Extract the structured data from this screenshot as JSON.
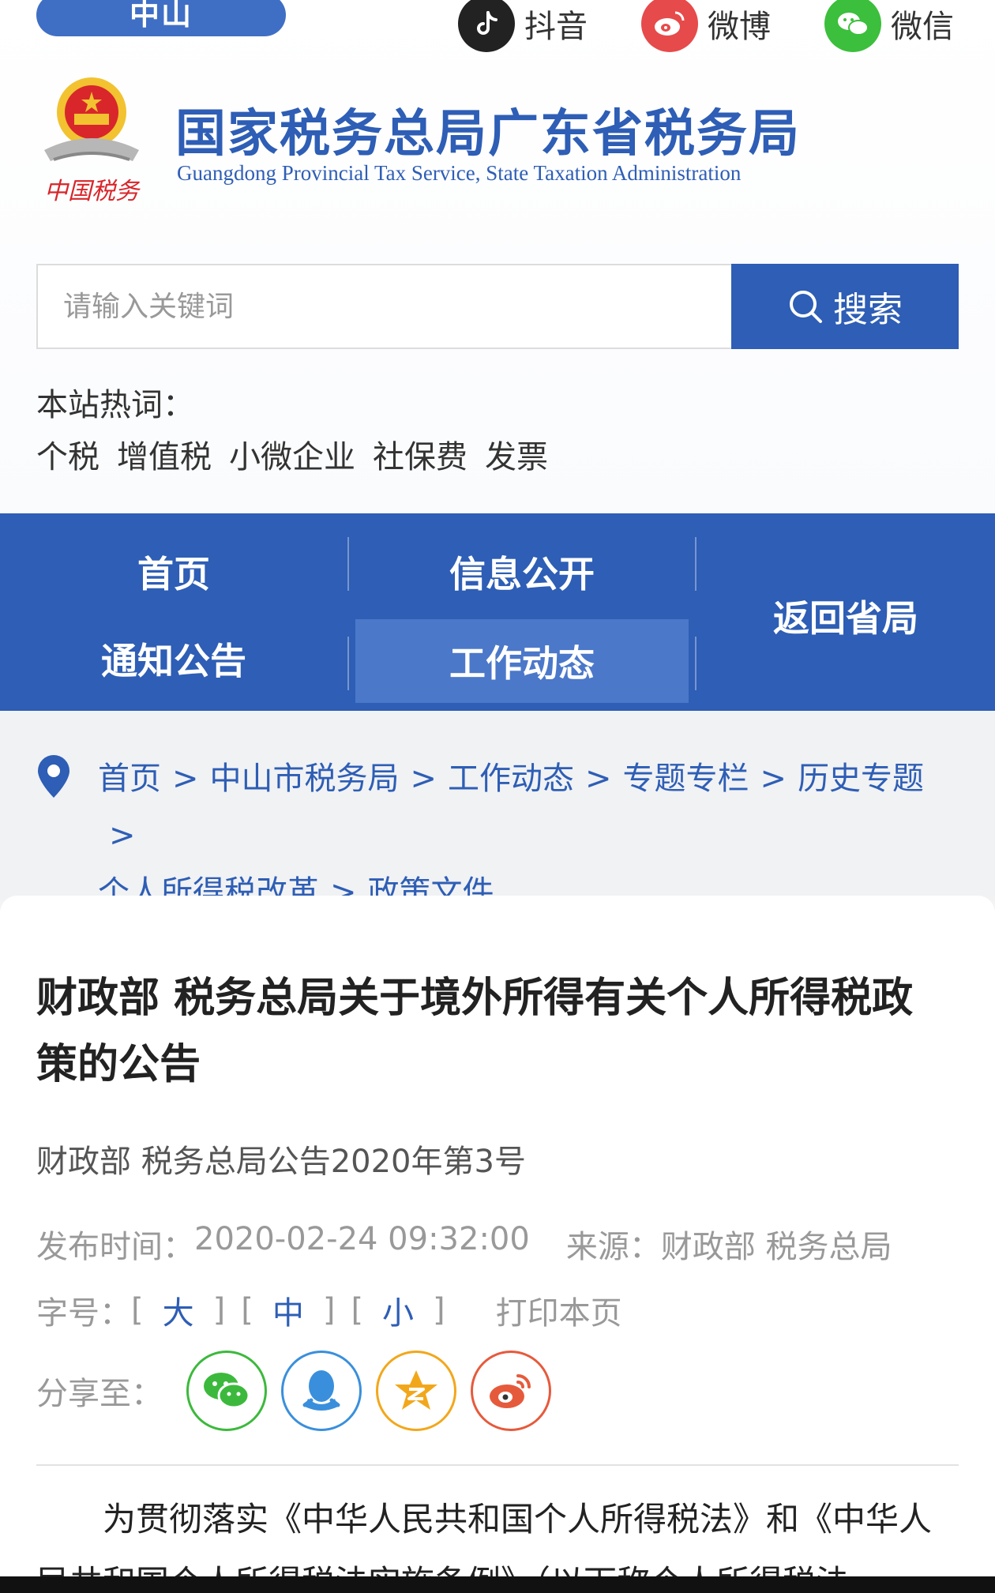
{
  "header": {
    "city_tab": "中山",
    "social": [
      {
        "label": "抖音",
        "icon": "douyin-icon"
      },
      {
        "label": "微博",
        "icon": "weibo-icon"
      },
      {
        "label": "微信",
        "icon": "wechat-icon"
      }
    ],
    "title_cn": "国家税务总局广东省税务局",
    "title_en": "Guangdong Provincial Tax Service, State Taxation Administration",
    "emblem_text": "中国税务"
  },
  "search": {
    "placeholder": "请输入关键词",
    "value": "",
    "button_label": "搜索"
  },
  "hot": {
    "label": "本站热词：",
    "words": [
      "个税",
      "增值税",
      "小微企业",
      "社保费",
      "发票"
    ]
  },
  "nav": {
    "items": [
      "首页",
      "信息公开",
      "通知公告",
      "工作动态",
      "返回省局"
    ],
    "active": "工作动态"
  },
  "breadcrumb": {
    "items": [
      "首页",
      "中山市税务局",
      "工作动态",
      "专题专栏",
      "历史专题",
      "个人所得税改革",
      "政策文件"
    ],
    "separator": ">"
  },
  "article": {
    "title": "财政部 税务总局关于境外所得有关个人所得税政策的公告",
    "doc_number": "财政部 税务总局公告2020年第3号",
    "publish_label": "发布时间：",
    "publish_time": "2020-02-24 09:32:00",
    "source_label": "来源：",
    "source": "财政部 税务总局",
    "font_label": "字号：",
    "font_sizes": [
      "大",
      "中",
      "小"
    ],
    "print_label": "打印本页",
    "share_label": "分享至：",
    "share_targets": [
      "wechat-share-icon",
      "qq-share-icon",
      "qzone-share-icon",
      "weibo-share-icon"
    ],
    "body_first_line": "为贯彻落实《中华人民共和国个人所得税法》和《中华人民共和国个人所得税法实施条例》（以下称个人所得税法"
  },
  "colors": {
    "brand_blue": "#2e5eb5",
    "nav_active": "#4b78c9",
    "wechat_green": "#3cb93c",
    "qq_blue": "#3a8fdc",
    "qzone_yellow": "#f2a71b",
    "weibo_red": "#e65a3c"
  }
}
